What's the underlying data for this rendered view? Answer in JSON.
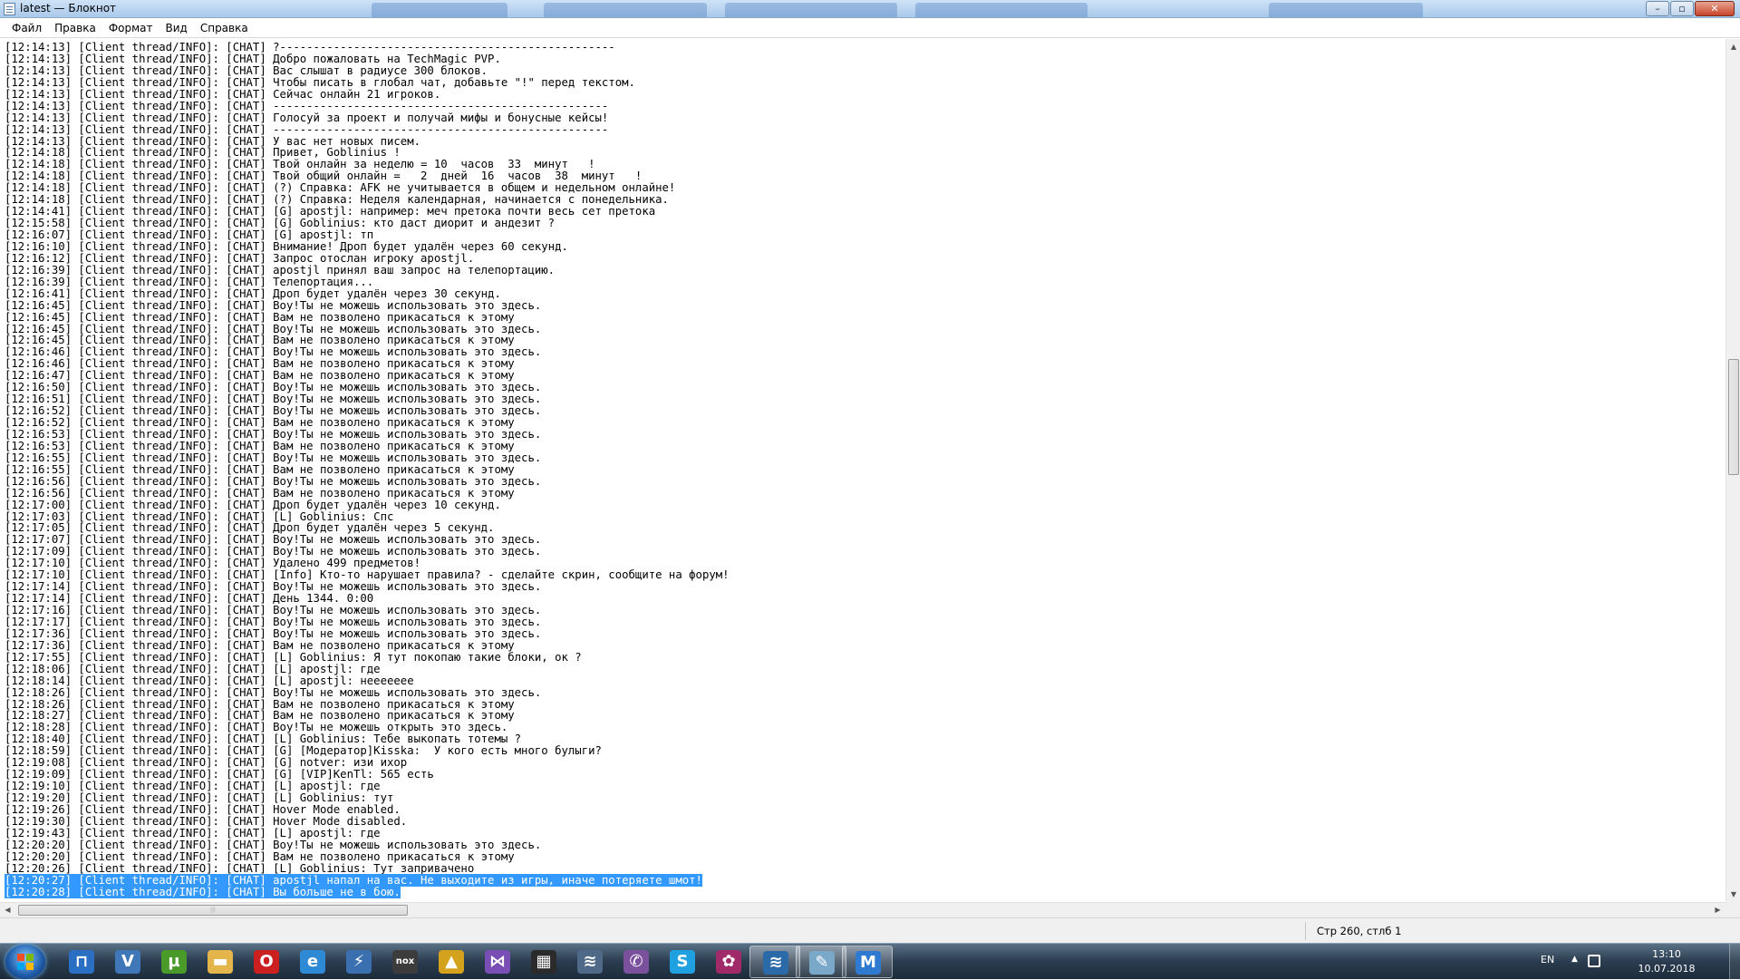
{
  "window": {
    "title": "latest — Блокнот"
  },
  "menu": [
    "Файл",
    "Правка",
    "Формат",
    "Вид",
    "Справка"
  ],
  "colors": {
    "selection": "#3399ff",
    "taskbar": "#2a3c4f"
  },
  "lines": [
    "[12:14:13] [Client thread/INFO]: [CHAT] ?--------------------------------------------------",
    "[12:14:13] [Client thread/INFO]: [CHAT] Добро пожаловать на TechMagic PVP.",
    "[12:14:13] [Client thread/INFO]: [CHAT] Вас слышат в радиусе 300 блоков.",
    "[12:14:13] [Client thread/INFO]: [CHAT] Чтобы писать в глобал чат, добавьте \"!\" перед текстом.",
    "[12:14:13] [Client thread/INFO]: [CHAT] Сейчас онлайн 21 игроков.",
    "[12:14:13] [Client thread/INFO]: [CHAT] --------------------------------------------------",
    "[12:14:13] [Client thread/INFO]: [CHAT] Голосуй за проект и получай мифы и бонусные кейсы!",
    "[12:14:13] [Client thread/INFO]: [CHAT] --------------------------------------------------",
    "[12:14:13] [Client thread/INFO]: [CHAT] У вас нет новых писем.",
    "[12:14:18] [Client thread/INFO]: [CHAT] Привет, Goblinius !",
    "[12:14:18] [Client thread/INFO]: [CHAT] Твой онлайн за неделю = 10  часов  33  минут   !",
    "[12:14:18] [Client thread/INFO]: [CHAT] Твой общий онлайн =   2  дней  16  часов  38  минут   !",
    "[12:14:18] [Client thread/INFO]: [CHAT] (?) Справка: AFK не учитывается в общем и недельном онлайне!",
    "[12:14:18] [Client thread/INFO]: [CHAT] (?) Справка: Неделя календарная, начинается с понедельника.",
    "[12:14:41] [Client thread/INFO]: [CHAT] [G] apostjl: например: меч претока почти весь сет претока",
    "[12:15:58] [Client thread/INFO]: [CHAT] [G] Goblinius: кто даст диорит и андезит ?",
    "[12:16:07] [Client thread/INFO]: [CHAT] [G] apostjl: тп",
    "[12:16:10] [Client thread/INFO]: [CHAT] Внимание! Дроп будет удалён через 60 секунд.",
    "[12:16:12] [Client thread/INFO]: [CHAT] Запрос отослан игроку apostjl.",
    "[12:16:39] [Client thread/INFO]: [CHAT] apostjl принял ваш запрос на телепортацию.",
    "[12:16:39] [Client thread/INFO]: [CHAT] Телепортация...",
    "[12:16:41] [Client thread/INFO]: [CHAT] Дроп будет удалён через 30 секунд.",
    "[12:16:45] [Client thread/INFO]: [CHAT] Воу!Ты не можешь использовать это здесь.",
    "[12:16:45] [Client thread/INFO]: [CHAT] Вам не позволено прикасаться к этому",
    "[12:16:45] [Client thread/INFO]: [CHAT] Воу!Ты не можешь использовать это здесь.",
    "[12:16:45] [Client thread/INFO]: [CHAT] Вам не позволено прикасаться к этому",
    "[12:16:46] [Client thread/INFO]: [CHAT] Воу!Ты не можешь использовать это здесь.",
    "[12:16:46] [Client thread/INFO]: [CHAT] Вам не позволено прикасаться к этому",
    "[12:16:47] [Client thread/INFO]: [CHAT] Вам не позволено прикасаться к этому",
    "[12:16:50] [Client thread/INFO]: [CHAT] Воу!Ты не можешь использовать это здесь.",
    "[12:16:51] [Client thread/INFO]: [CHAT] Воу!Ты не можешь использовать это здесь.",
    "[12:16:52] [Client thread/INFO]: [CHAT] Воу!Ты не можешь использовать это здесь.",
    "[12:16:52] [Client thread/INFO]: [CHAT] Вам не позволено прикасаться к этому",
    "[12:16:53] [Client thread/INFO]: [CHAT] Воу!Ты не можешь использовать это здесь.",
    "[12:16:53] [Client thread/INFO]: [CHAT] Вам не позволено прикасаться к этому",
    "[12:16:55] [Client thread/INFO]: [CHAT] Воу!Ты не можешь использовать это здесь.",
    "[12:16:55] [Client thread/INFO]: [CHAT] Вам не позволено прикасаться к этому",
    "[12:16:56] [Client thread/INFO]: [CHAT] Воу!Ты не можешь использовать это здесь.",
    "[12:16:56] [Client thread/INFO]: [CHAT] Вам не позволено прикасаться к этому",
    "[12:17:00] [Client thread/INFO]: [CHAT] Дроп будет удалён через 10 секунд.",
    "[12:17:03] [Client thread/INFO]: [CHAT] [L] Goblinius: Спс",
    "[12:17:05] [Client thread/INFO]: [CHAT] Дроп будет удалён через 5 секунд.",
    "[12:17:07] [Client thread/INFO]: [CHAT] Воу!Ты не можешь использовать это здесь.",
    "[12:17:09] [Client thread/INFO]: [CHAT] Воу!Ты не можешь использовать это здесь.",
    "[12:17:10] [Client thread/INFO]: [CHAT] Удалено 499 предметов!",
    "[12:17:10] [Client thread/INFO]: [CHAT] [Info] Кто-то нарушает правила? - сделайте скрин, сообщите на форум!",
    "[12:17:14] [Client thread/INFO]: [CHAT] Воу!Ты не можешь использовать это здесь.",
    "[12:17:14] [Client thread/INFO]: [CHAT] День 1344. 0:00",
    "[12:17:16] [Client thread/INFO]: [CHAT] Воу!Ты не можешь использовать это здесь.",
    "[12:17:17] [Client thread/INFO]: [CHAT] Воу!Ты не можешь использовать это здесь.",
    "[12:17:36] [Client thread/INFO]: [CHAT] Воу!Ты не можешь использовать это здесь.",
    "[12:17:36] [Client thread/INFO]: [CHAT] Вам не позволено прикасаться к этому",
    "[12:17:55] [Client thread/INFO]: [CHAT] [L] Goblinius: Я тут покопаю такие блоки, ок ?",
    "[12:18:06] [Client thread/INFO]: [CHAT] [L] apostjl: где",
    "[12:18:14] [Client thread/INFO]: [CHAT] [L] apostjl: неееееее",
    "[12:18:26] [Client thread/INFO]: [CHAT] Воу!Ты не можешь использовать это здесь.",
    "[12:18:26] [Client thread/INFO]: [CHAT] Вам не позволено прикасаться к этому",
    "[12:18:27] [Client thread/INFO]: [CHAT] Вам не позволено прикасаться к этому",
    "[12:18:28] [Client thread/INFO]: [CHAT] Воу!Ты не можешь открыть это здесь.",
    "[12:18:40] [Client thread/INFO]: [CHAT] [L] Goblinius: Тебе выкопать тотемы ?",
    "[12:18:59] [Client thread/INFO]: [CHAT] [G] [Модератор]Kisska:  У кого есть много булыги?",
    "[12:19:08] [Client thread/INFO]: [CHAT] [G] notver: изи ихор",
    "[12:19:09] [Client thread/INFO]: [CHAT] [G] [VIP]KenTl: 565 есть",
    "[12:19:10] [Client thread/INFO]: [CHAT] [L] apostjl: где",
    "[12:19:20] [Client thread/INFO]: [CHAT] [L] Goblinius: тут",
    "[12:19:26] [Client thread/INFO]: [CHAT] Hover Mode enabled.",
    "[12:19:30] [Client thread/INFO]: [CHAT] Hover Mode disabled.",
    "[12:19:43] [Client thread/INFO]: [CHAT] [L] apostjl: где",
    "[12:20:20] [Client thread/INFO]: [CHAT] Воу!Ты не можешь использовать это здесь.",
    "[12:20:20] [Client thread/INFO]: [CHAT] Вам не позволено прикасаться к этому",
    "[12:20:26] [Client thread/INFO]: [CHAT] [L] Goblinius: Тут заприваченo",
    "[12:20:27] [Client thread/INFO]: [CHAT] apostjl напал на вас. Не выходите из игры, иначе потеряете шмот!",
    "[12:20:28] [Client thread/INFO]: [CHAT] Вы больше не в бою."
  ],
  "selected_lines": [
    71,
    72
  ],
  "status": {
    "position": "Стр 260, стлб 1"
  },
  "taskbar": {
    "apps": [
      {
        "name": "windows-explorer-icon",
        "glyph": "⊓",
        "color": "#2b6fc4"
      },
      {
        "name": "vk-icon",
        "glyph": "V",
        "color": "#3f77b8"
      },
      {
        "name": "utorrent-icon",
        "glyph": "µ",
        "color": "#4a9a2a"
      },
      {
        "name": "folder-icon",
        "glyph": "▬",
        "color": "#e3b54a"
      },
      {
        "name": "opera-icon",
        "glyph": "O",
        "color": "#cc1f1f"
      },
      {
        "name": "internet-explorer-icon",
        "glyph": "e",
        "color": "#2f8ad6"
      },
      {
        "name": "lightning-app-icon",
        "glyph": "⚡",
        "color": "#3a6fb0"
      },
      {
        "name": "nox-icon",
        "glyph": "nox",
        "color": "#3c3c3c"
      },
      {
        "name": "warning-app-icon",
        "glyph": "▲",
        "color": "#d4a21c"
      },
      {
        "name": "visual-studio-icon",
        "glyph": "⋈",
        "color": "#7a4fb5"
      },
      {
        "name": "video-editor-icon",
        "glyph": "▦",
        "color": "#2b2b2b"
      },
      {
        "name": "wifi-app-icon",
        "glyph": "≋",
        "color": "#4e6a88"
      },
      {
        "name": "viber-icon",
        "glyph": "✆",
        "color": "#7b519d"
      },
      {
        "name": "skype-icon",
        "glyph": "S",
        "color": "#1fa0e0"
      },
      {
        "name": "flower-app-icon",
        "glyph": "✿",
        "color": "#a02a6a"
      },
      {
        "name": "wifi-manager-icon",
        "glyph": "≋",
        "color": "#2a6aa8"
      },
      {
        "name": "notepad-icon",
        "glyph": "✎",
        "color": "#7aa8c8"
      },
      {
        "name": "maxthon-icon",
        "glyph": "M",
        "color": "#2d7ad0"
      }
    ],
    "active_indices": [
      15,
      16,
      17
    ],
    "lang": "EN",
    "time": "13:10",
    "date": "10.07.2018"
  }
}
